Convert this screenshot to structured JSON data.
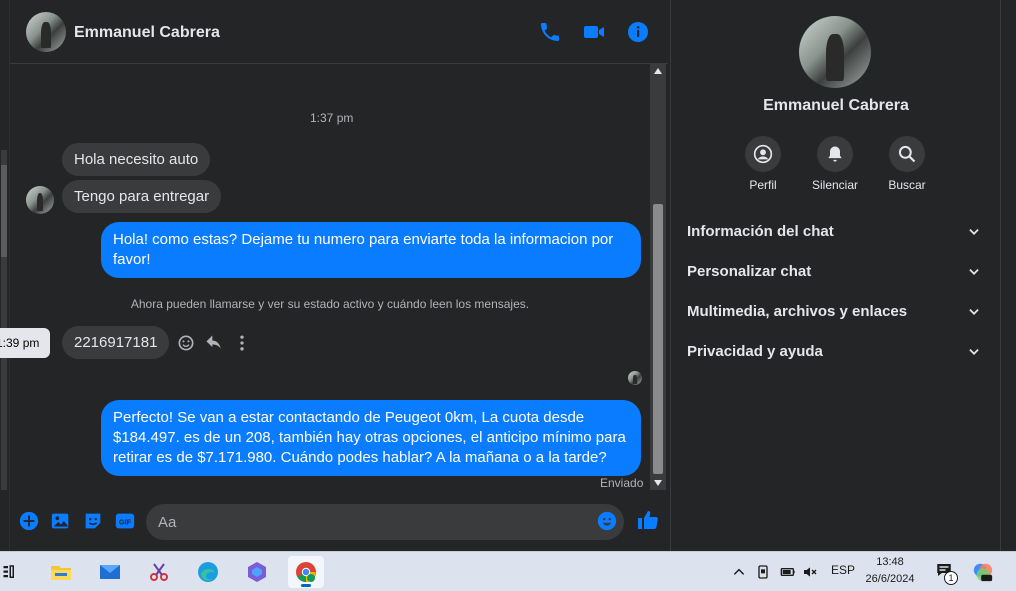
{
  "contact": {
    "name": "Emmanuel Cabrera"
  },
  "conversation": {
    "timestamp_1": "1:37 pm",
    "incoming_1": "Hola necesito auto",
    "incoming_2": "Tengo para entregar",
    "outgoing_1": "Hola! como estas? Dejame tu numero para enviarte toda la informacion por favor!",
    "notice": "Ahora pueden llamarse y ver su estado activo y cuándo leen los mensajes.",
    "tooltip_time": "1:39 pm",
    "incoming_3": "2216917181",
    "outgoing_2": "Perfecto!  Se van a estar contactando de Peugeot 0km, La cuota desde $184.497. es de un 208, también hay otras opciones, el anticipo mínimo para retirar es de $7.171.980. Cuándo podes hablar? A la mañana o a la tarde?",
    "status": "Enviado"
  },
  "composer": {
    "placeholder": "Aa"
  },
  "panel": {
    "actions": [
      {
        "label": "Perfil",
        "icon": "profile-icon"
      },
      {
        "label": "Silenciar",
        "icon": "bell-icon"
      },
      {
        "label": "Buscar",
        "icon": "search-icon"
      }
    ],
    "sections": [
      "Información del chat",
      "Personalizar chat",
      "Multimedia, archivos y enlaces",
      "Privacidad y ayuda"
    ]
  },
  "taskbar": {
    "language": "ESP",
    "time": "13:48",
    "date": "26/6/2024",
    "notification_count": "1"
  },
  "colors": {
    "accent": "#0a7cff",
    "background": "#242526",
    "bubble_in": "#3a3b3c"
  }
}
